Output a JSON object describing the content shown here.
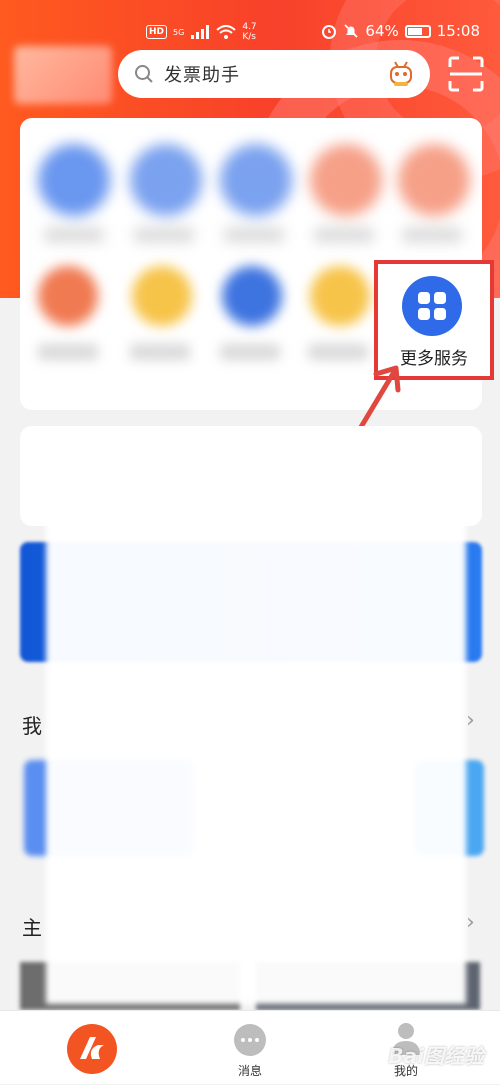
{
  "status_bar": {
    "network_badge": "HD",
    "signal_type": "5G",
    "speed_value": "4.7",
    "speed_unit": "K/s",
    "battery": "64%",
    "battery_level": 0.64,
    "time": "15:08"
  },
  "search": {
    "placeholder": "发票助手"
  },
  "services": {
    "more_label": "更多服务"
  },
  "sections": {
    "my_partial": "我",
    "theme_partial": "主"
  },
  "tabbar": {
    "messages_label": "消息",
    "mine_label": "我的"
  },
  "watermark": {
    "text": "Bai图经验"
  },
  "colors": {
    "brand": "#f8412a",
    "highlight": "#e53935",
    "more_icon": "#2f6be8"
  }
}
